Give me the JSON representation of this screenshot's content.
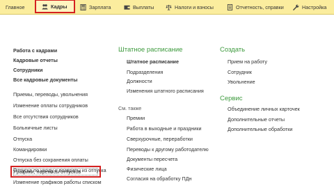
{
  "top_tabs": [
    {
      "label": "Главное",
      "icon": "none"
    },
    {
      "label": "Кадры",
      "icon": "people-icon",
      "active": true
    },
    {
      "label": "Зарплата",
      "icon": "calculator-icon"
    },
    {
      "label": "Выплаты",
      "icon": "wallet-icon"
    },
    {
      "label": "Налоги и взносы",
      "icon": "scales-icon"
    },
    {
      "label": "Отчетность, справки",
      "icon": "report-icon"
    },
    {
      "label": "Настройка",
      "icon": "wrench-icon"
    }
  ],
  "left_column": {
    "bold_links": [
      "Работа с кадрами",
      "Кадровые отчеты",
      "Сотрудники",
      "Все кадровые документы"
    ],
    "links": [
      "Приемы, переводы, увольнения",
      "Изменение оплаты сотрудников",
      "Все отсутствия сотрудников",
      "Больничные листы",
      "Отпуска",
      "Командировки",
      "Отпуска без сохранения оплаты",
      "Отпуска по уходу и возвраты из отпуска",
      "Графики, переносы отпусков",
      "Изменение графиков работы списком"
    ]
  },
  "middle_column": {
    "heading": "Штатное расписание",
    "bold_link": "Штатное расписание",
    "links": [
      "Подразделения",
      "Должности",
      "Изменения штатного расписания"
    ],
    "see_also": "См. также",
    "see_also_links": [
      "Премии",
      "Работа в выходные и праздники",
      "Сверхурочные, переработки",
      "Переводы к другому работодателю",
      "Документы пересчета",
      "Физические лица",
      "Согласия на обработку ПДн"
    ]
  },
  "right_column": {
    "create_heading": "Создать",
    "create_links": [
      "Прием на работу",
      "Сотрудник",
      "Увольнение"
    ],
    "service_heading": "Сервис",
    "service_links": [
      "Объединение личных карточек",
      "Дополнительные отчеты",
      "Дополнительные обработки"
    ]
  },
  "colors": {
    "topbar": "#fbed9e",
    "heading_green": "#3d9a3d",
    "highlight_red": "#d42020"
  }
}
